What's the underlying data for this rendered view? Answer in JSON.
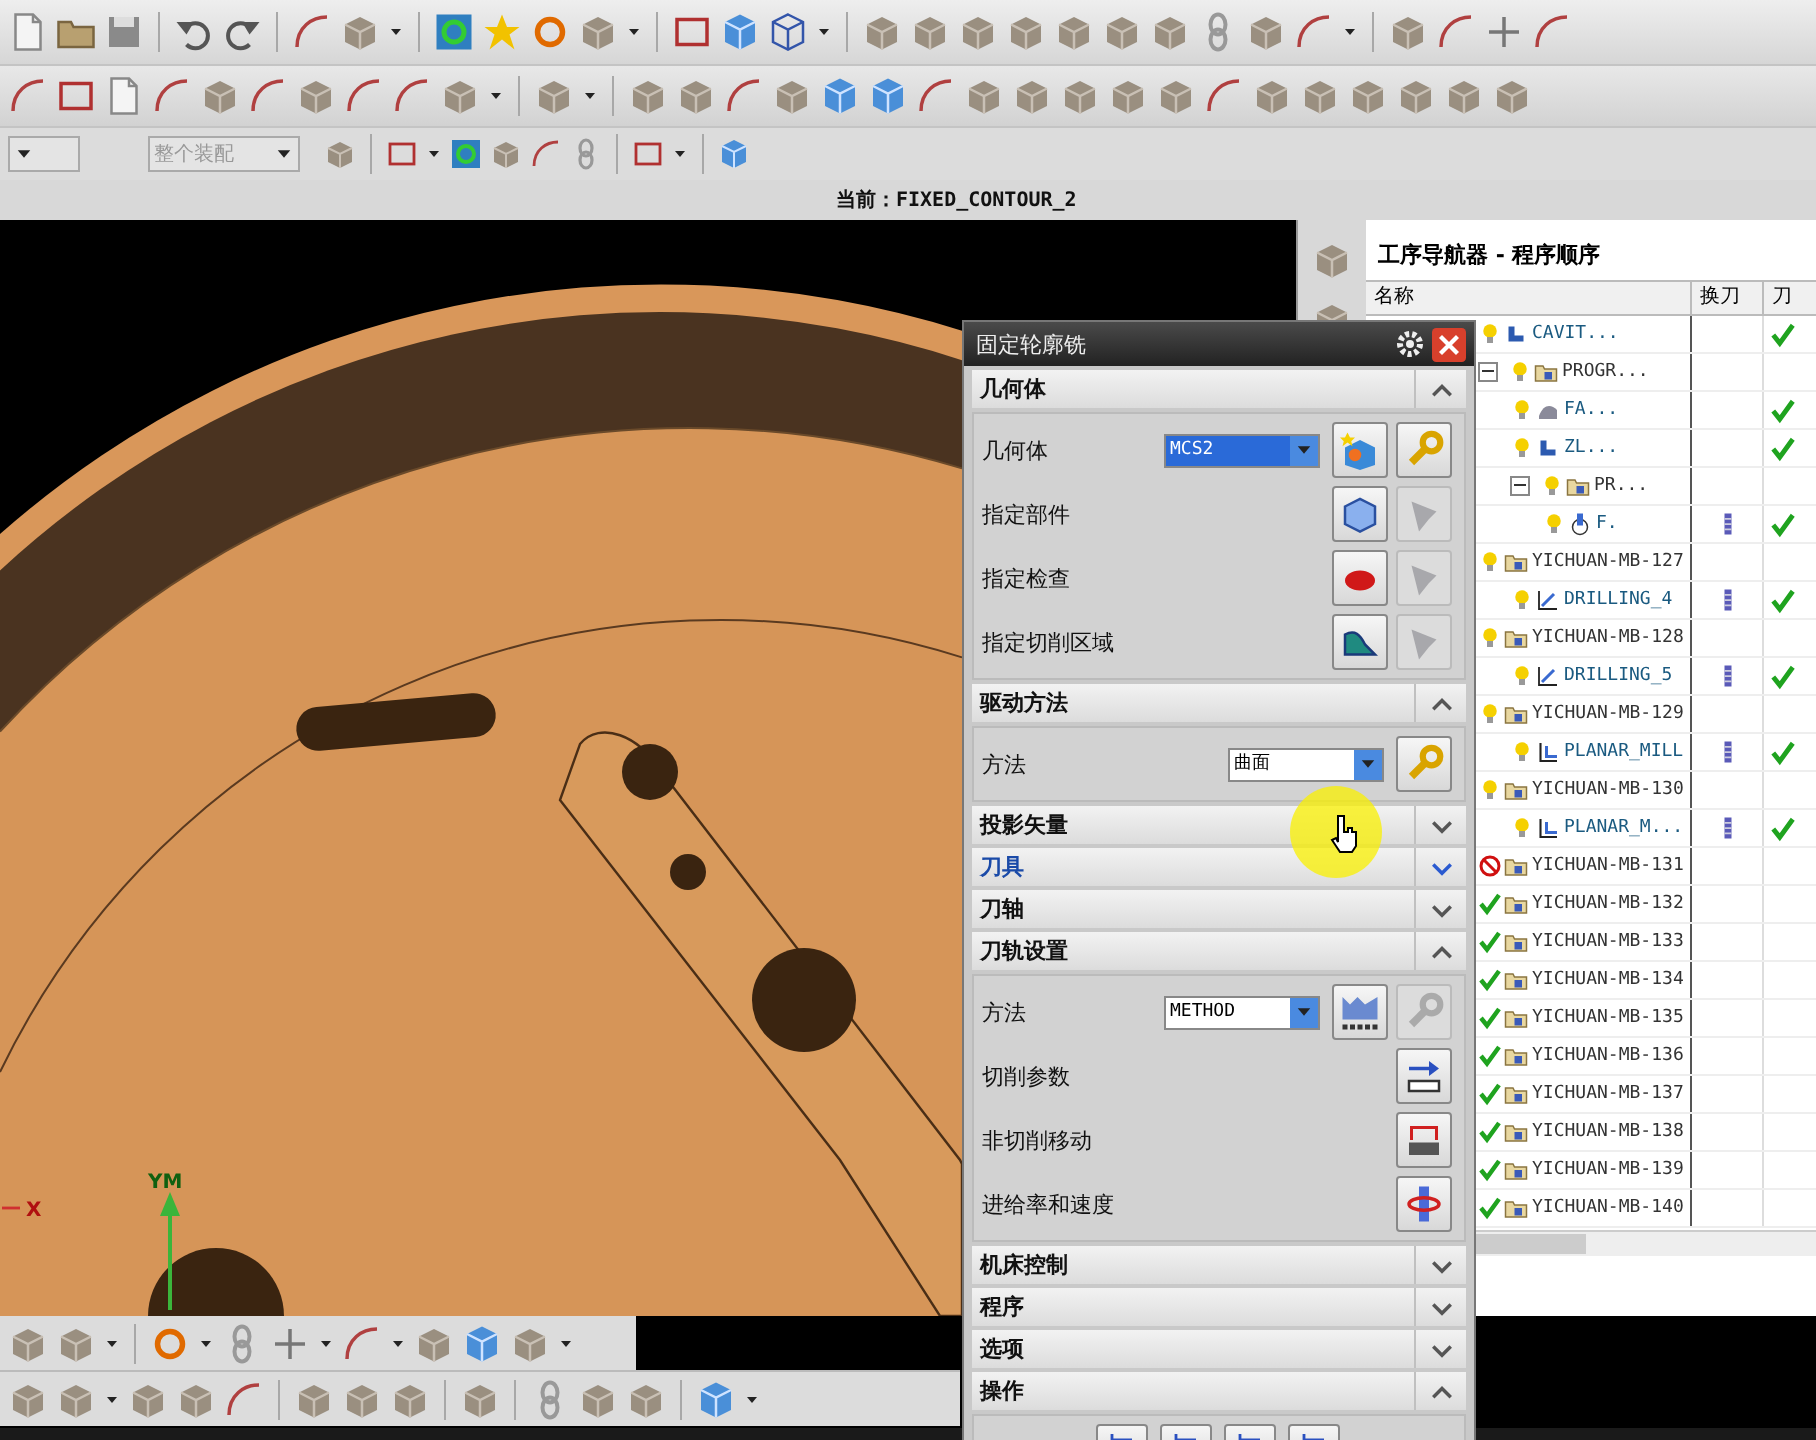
{
  "toolbar": {
    "filter_dropdown": {
      "value": "整个装配",
      "disabled": true
    }
  },
  "status_line": "当前：FIXED_CONTOUR_2",
  "viewport": {
    "axis_labels": [
      "YM",
      "X"
    ]
  },
  "navigator": {
    "title": "工序导航器 - 程序顺序",
    "columns": [
      "名称",
      "换刀",
      "刀"
    ],
    "rows": [
      {
        "name": "CAVIT...",
        "kind": "cavity",
        "needs_update": true,
        "tool_change": false,
        "path_ok": true
      },
      {
        "name": "PROGR...",
        "kind": "program",
        "needs_update": true,
        "expanded": true,
        "children": [
          {
            "name": "FA...",
            "kind": "surface",
            "needs_update": true,
            "tool_change": false,
            "path_ok": true
          },
          {
            "name": "ZL...",
            "kind": "cavity",
            "needs_update": true,
            "tool_change": false,
            "path_ok": true
          },
          {
            "name": "PR...",
            "kind": "program",
            "needs_update": true,
            "expanded": true,
            "children": [
              {
                "name": "F.",
                "kind": "contour",
                "needs_update": true,
                "tool_change": true,
                "path_ok": true
              }
            ]
          }
        ]
      },
      {
        "name": "YICHUAN-MB-127",
        "kind": "program",
        "needs_update": true,
        "children": [
          {
            "name": "DRILLING_4",
            "kind": "drill",
            "needs_update": true,
            "tool_change": true,
            "path_ok": true
          }
        ]
      },
      {
        "name": "YICHUAN-MB-128",
        "kind": "program",
        "needs_update": true,
        "children": [
          {
            "name": "DRILLING_5",
            "kind": "drill",
            "needs_update": true,
            "tool_change": true,
            "path_ok": true
          }
        ]
      },
      {
        "name": "YICHUAN-MB-129",
        "kind": "program",
        "needs_update": true,
        "children": [
          {
            "name": "PLANAR_MILL",
            "kind": "planar",
            "needs_update": true,
            "tool_change": true,
            "path_ok": true
          }
        ]
      },
      {
        "name": "YICHUAN-MB-130",
        "kind": "program",
        "needs_update": true,
        "children": [
          {
            "name": "PLANAR_M...",
            "kind": "planar",
            "needs_update": true,
            "tool_change": true,
            "path_ok": true
          }
        ]
      },
      {
        "name": "YICHUAN-MB-131",
        "kind": "program",
        "blocked": true
      },
      {
        "name": "YICHUAN-MB-132",
        "kind": "program",
        "needs_update": false,
        "blocked": false
      },
      {
        "name": "YICHUAN-MB-133",
        "kind": "program",
        "needs_update": false,
        "blocked": false
      },
      {
        "name": "YICHUAN-MB-134",
        "kind": "program",
        "needs_update": false,
        "blocked": false
      },
      {
        "name": "YICHUAN-MB-135",
        "kind": "program",
        "needs_update": false,
        "blocked": false
      },
      {
        "name": "YICHUAN-MB-136",
        "kind": "program",
        "needs_update": false,
        "blocked": false
      },
      {
        "name": "YICHUAN-MB-137",
        "kind": "program",
        "needs_update": false,
        "blocked": false
      },
      {
        "name": "YICHUAN-MB-138",
        "kind": "program",
        "needs_update": false,
        "blocked": false
      },
      {
        "name": "YICHUAN-MB-139",
        "kind": "program",
        "needs_update": false,
        "blocked": false
      },
      {
        "name": "YICHUAN-MB-140",
        "kind": "program",
        "needs_update": false,
        "blocked": false
      }
    ]
  },
  "dialog": {
    "title": "固定轮廓铣",
    "sections": [
      {
        "title": "几何体",
        "expanded": true,
        "hovered": false,
        "rows": [
          {
            "label": "几何体",
            "kind": "select",
            "value": "MCS2",
            "highlighted": true,
            "edit_enabled": true
          },
          {
            "label": "指定部件",
            "kind": "pick",
            "edit_enabled": false
          },
          {
            "label": "指定检查",
            "kind": "pick",
            "edit_enabled": false
          },
          {
            "label": "指定切削区域",
            "kind": "pick",
            "edit_enabled": false
          }
        ]
      },
      {
        "title": "驱动方法",
        "expanded": true,
        "hovered": false,
        "rows": [
          {
            "label": "方法",
            "kind": "select",
            "value": "曲面",
            "highlighted": false,
            "edit_enabled": true
          }
        ]
      },
      {
        "title": "投影矢量",
        "expanded": false,
        "hovered": false
      },
      {
        "title": "刀具",
        "expanded": false,
        "hovered": true
      },
      {
        "title": "刀轴",
        "expanded": false,
        "hovered": false
      },
      {
        "title": "刀轨设置",
        "expanded": true,
        "hovered": false,
        "rows": [
          {
            "label": "方法",
            "kind": "select",
            "value": "METHOD",
            "highlighted": false,
            "edit_enabled": false
          },
          {
            "label": "切削参数",
            "kind": "action"
          },
          {
            "label": "非切削移动",
            "kind": "action"
          },
          {
            "label": "进给率和速度",
            "kind": "action"
          }
        ]
      },
      {
        "title": "机床控制",
        "expanded": false,
        "hovered": false
      },
      {
        "title": "程序",
        "expanded": false,
        "hovered": false
      },
      {
        "title": "选项",
        "expanded": false,
        "hovered": false
      },
      {
        "title": "操作",
        "expanded": true,
        "hovered": false,
        "rows": [
          {
            "kind": "buttons"
          }
        ]
      }
    ]
  }
}
